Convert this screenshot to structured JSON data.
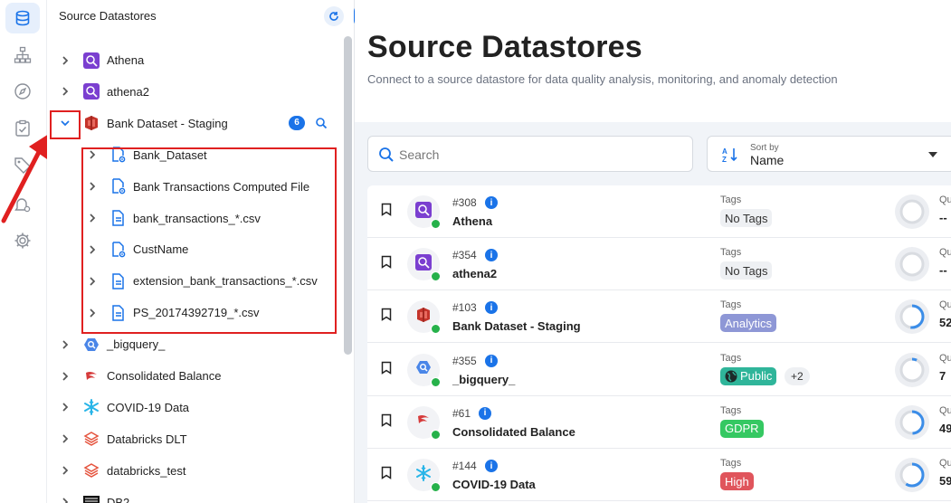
{
  "rail": {
    "items": [
      {
        "name": "database-icon",
        "active": true
      },
      {
        "name": "hierarchy-icon",
        "active": false
      },
      {
        "name": "compass-icon",
        "active": false
      },
      {
        "name": "clipboard-check-icon",
        "active": false
      },
      {
        "name": "tag-icon",
        "active": false
      },
      {
        "name": "bell-settings-icon",
        "active": false
      },
      {
        "name": "gear-icon",
        "active": false
      }
    ]
  },
  "tree": {
    "title": "Source Datastores",
    "items": [
      {
        "label": "Athena",
        "icon": "athena-icon"
      },
      {
        "label": "athena2",
        "icon": "athena-icon"
      },
      {
        "label": "Bank Dataset - Staging",
        "icon": "redshift-icon",
        "expanded": true,
        "count": "6"
      },
      {
        "label": "Bank_Dataset",
        "icon": "computed-file-icon",
        "child": true
      },
      {
        "label": "Bank Transactions Computed File",
        "icon": "computed-file-icon",
        "child": true
      },
      {
        "label": "bank_transactions_*.csv",
        "icon": "file-icon",
        "child": true
      },
      {
        "label": "CustName",
        "icon": "computed-file-icon",
        "child": true
      },
      {
        "label": "extension_bank_transactions_*.csv",
        "icon": "file-icon",
        "child": true
      },
      {
        "label": "PS_20174392719_*.csv",
        "icon": "file-icon",
        "child": true
      },
      {
        "label": "_bigquery_",
        "icon": "bigquery-icon"
      },
      {
        "label": "Consolidated Balance",
        "icon": "consolidated-icon"
      },
      {
        "label": "COVID-19 Data",
        "icon": "snowflake-icon"
      },
      {
        "label": "Databricks DLT",
        "icon": "databricks-icon"
      },
      {
        "label": "databricks_test",
        "icon": "databricks-icon"
      },
      {
        "label": "DB2",
        "icon": "ibm-icon"
      }
    ]
  },
  "main": {
    "title": "Source Datastores",
    "subtitle": "Connect to a source datastore for data quality analysis, monitoring, and anomaly detection",
    "search": {
      "placeholder": "Search"
    },
    "sort": {
      "caption": "Sort by",
      "value": "Name"
    },
    "tags_caption": "Tags",
    "quality_caption": "Qu",
    "cards": [
      {
        "id": "#308",
        "name": "Athena",
        "icon": "athena-icon",
        "tag": "No Tags",
        "tag_color": "",
        "extra": "",
        "quality": "--",
        "score": 0
      },
      {
        "id": "#354",
        "name": "athena2",
        "icon": "athena-icon",
        "tag": "No Tags",
        "tag_color": "",
        "extra": "",
        "quality": "--",
        "score": 0
      },
      {
        "id": "#103",
        "name": "Bank Dataset - Staging",
        "icon": "redshift-icon",
        "tag": "Analytics",
        "tag_color": "#8e97d6",
        "extra": "",
        "quality": "52",
        "score": 0.52
      },
      {
        "id": "#355",
        "name": "_bigquery_",
        "icon": "bigquery-icon",
        "tag": "Public",
        "tag_color": "#2fb59a",
        "extra": "+2",
        "quality": "7",
        "score": 0.07
      },
      {
        "id": "#61",
        "name": "Consolidated Balance",
        "icon": "consolidated-icon",
        "tag": "GDPR",
        "tag_color": "#35c862",
        "extra": "",
        "quality": "49",
        "score": 0.49
      },
      {
        "id": "#144",
        "name": "COVID-19 Data",
        "icon": "snowflake-icon",
        "tag": "High",
        "tag_color": "#e0555c",
        "extra": "",
        "quality": "59",
        "score": 0.59
      }
    ]
  },
  "colors": {
    "accent": "#1a73e8",
    "highlight": "#e02020",
    "status_ok": "#26b14a"
  }
}
